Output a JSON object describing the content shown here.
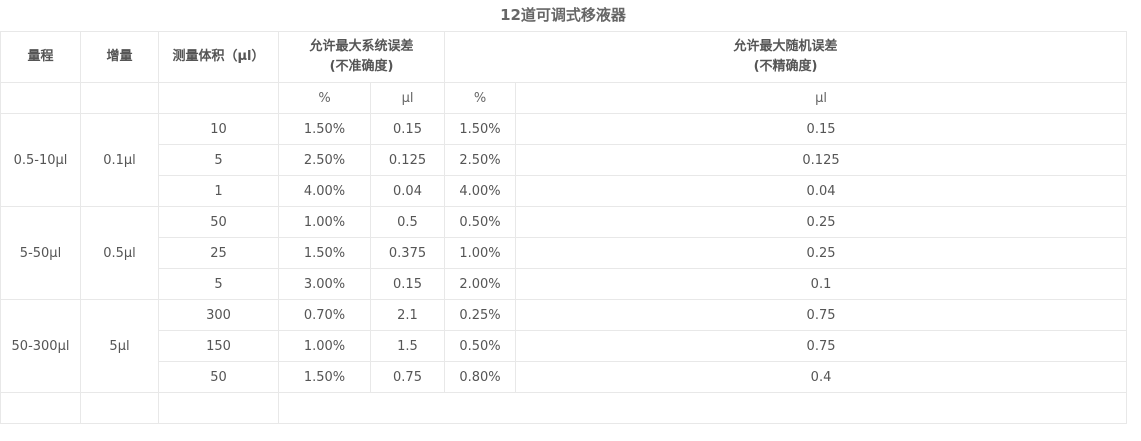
{
  "title": "12道可调式移液器",
  "headers": {
    "range": "量程",
    "increment": "增量",
    "volume": "测量体积（μl）",
    "sys_error_line1": "允许最大系统误差",
    "sys_error_line2": "(不准确度)",
    "rand_error_line1": "允许最大随机误差",
    "rand_error_line2": "(不精确度)",
    "pct": "%",
    "ul": "μl"
  },
  "groups": [
    {
      "range": "0.5-10μl",
      "increment": "0.1μl",
      "rows": [
        {
          "volume": "10",
          "sys_pct": "1.50%",
          "sys_ul": "0.15",
          "rand_pct": "1.50%",
          "rand_ul": "0.15"
        },
        {
          "volume": "5",
          "sys_pct": "2.50%",
          "sys_ul": "0.125",
          "rand_pct": "2.50%",
          "rand_ul": "0.125"
        },
        {
          "volume": "1",
          "sys_pct": "4.00%",
          "sys_ul": "0.04",
          "rand_pct": "4.00%",
          "rand_ul": "0.04"
        }
      ]
    },
    {
      "range": "5-50μl",
      "increment": "0.5μl",
      "rows": [
        {
          "volume": "50",
          "sys_pct": "1.00%",
          "sys_ul": "0.5",
          "rand_pct": "0.50%",
          "rand_ul": "0.25"
        },
        {
          "volume": "25",
          "sys_pct": "1.50%",
          "sys_ul": "0.375",
          "rand_pct": "1.00%",
          "rand_ul": "0.25"
        },
        {
          "volume": "5",
          "sys_pct": "3.00%",
          "sys_ul": "0.15",
          "rand_pct": "2.00%",
          "rand_ul": "0.1"
        }
      ]
    },
    {
      "range": "50-300μl",
      "increment": "5μl",
      "rows": [
        {
          "volume": "300",
          "sys_pct": "0.70%",
          "sys_ul": "2.1",
          "rand_pct": "0.25%",
          "rand_ul": "0.75"
        },
        {
          "volume": "150",
          "sys_pct": "1.00%",
          "sys_ul": "1.5",
          "rand_pct": "0.50%",
          "rand_ul": "0.75"
        },
        {
          "volume": "50",
          "sys_pct": "1.50%",
          "sys_ul": "0.75",
          "rand_pct": "0.80%",
          "rand_ul": "0.4"
        }
      ]
    }
  ]
}
